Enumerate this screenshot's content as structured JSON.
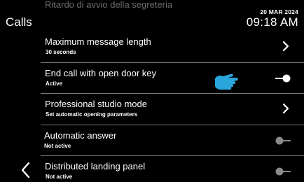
{
  "header": {
    "title": "Calls",
    "date": "20 MAR 2024",
    "time": "09:18 AM",
    "partial_row": "Ritardo di avvio della segreteria"
  },
  "settings": [
    {
      "label": "Maximum message length",
      "sub": "30 seconds",
      "control": "chevron"
    },
    {
      "label": "End call with open door key",
      "sub": "Active",
      "control": "toggle",
      "state": "on"
    },
    {
      "label": "Professional studio mode",
      "sub": "Set automatic opening parameters",
      "control": "chevron"
    },
    {
      "label": "Automatic answer",
      "sub": "Not active",
      "control": "toggle",
      "state": "off"
    },
    {
      "label": "Distributed landing panel",
      "sub": "Not active",
      "control": "toggle",
      "state": "off"
    }
  ],
  "icons": {
    "back": "chevron-left-icon",
    "hand": "pointing-hand-icon"
  },
  "colors": {
    "background": "#000000",
    "divider": "#7a7a7a",
    "toggle_on": "#ffffff",
    "toggle_off": "#8a8a8a",
    "hand": "#2aa6dd"
  }
}
